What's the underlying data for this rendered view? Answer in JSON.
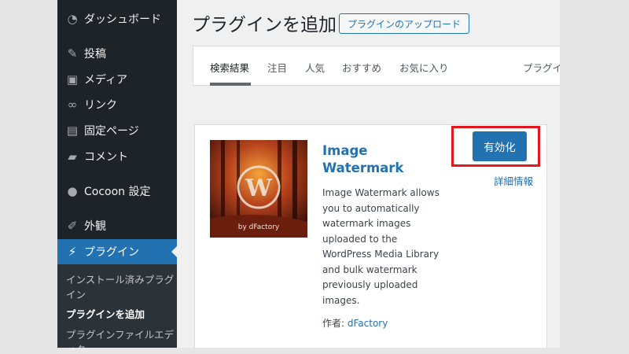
{
  "sidebar": {
    "items": [
      {
        "label": "ダッシュボード",
        "icon": "dashboard-icon"
      },
      {
        "label": "投稿",
        "icon": "pin-icon"
      },
      {
        "label": "メディア",
        "icon": "media-icon"
      },
      {
        "label": "リンク",
        "icon": "link-icon"
      },
      {
        "label": "固定ページ",
        "icon": "page-icon"
      },
      {
        "label": "コメント",
        "icon": "comment-icon"
      },
      {
        "label": "Cocoon 設定",
        "icon": "circle-icon"
      },
      {
        "label": "外観",
        "icon": "brush-icon"
      },
      {
        "label": "プラグイン",
        "icon": "plug-icon",
        "active": true
      }
    ],
    "submenu": {
      "installed": "インストール済みプラグイン",
      "add_new": "プラグインを追加",
      "editor": "プラグインファイルエディター"
    }
  },
  "header": {
    "title": "プラグインを追加",
    "upload_button": "プラグインのアップロード"
  },
  "filter": {
    "tabs": [
      "検索結果",
      "注目",
      "人気",
      "おすすめ",
      "お気に入り"
    ],
    "right_label": "プラグイ"
  },
  "plugin": {
    "name": "Image Watermark",
    "description": "Image Watermark allows you to automatically watermark images uploaded to the WordPress Media Library and bulk watermark previously uploaded images.",
    "author_label": "作者:",
    "author_name": "dFactory",
    "activate_label": "有効化",
    "details_label": "詳細情報",
    "thumb_text": "by dFactory"
  },
  "colors": {
    "accent": "#2271b1",
    "sidebar_bg": "#1d2327",
    "highlight": "#e3161c"
  }
}
